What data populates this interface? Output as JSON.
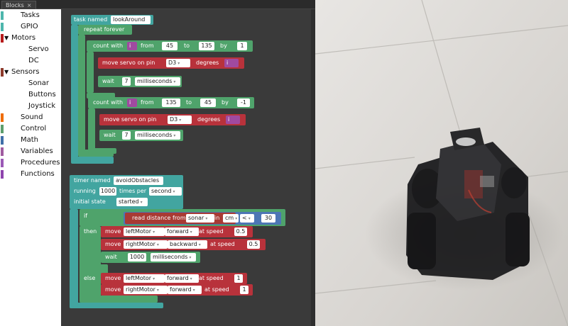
{
  "tab": {
    "label": "Blocks",
    "close": "×"
  },
  "toolbox": [
    {
      "label": "Tasks",
      "color": "#4db6ac",
      "indent": 0
    },
    {
      "label": "GPIO",
      "color": "#4db6ac",
      "indent": 0
    },
    {
      "label": "Motors",
      "color": "#b71c1c",
      "indent": 0,
      "expanded": true
    },
    {
      "label": "Servo",
      "color": "",
      "indent": 1
    },
    {
      "label": "DC",
      "color": "",
      "indent": 1
    },
    {
      "label": "Sensors",
      "color": "#8d3a2b",
      "indent": 0,
      "expanded": true
    },
    {
      "label": "Sonar",
      "color": "",
      "indent": 1
    },
    {
      "label": "Buttons",
      "color": "",
      "indent": 1
    },
    {
      "label": "Joystick",
      "color": "",
      "indent": 1
    },
    {
      "label": "Sound",
      "color": "#ef6c00",
      "indent": 0
    },
    {
      "label": "Control",
      "color": "#5c9e6c",
      "indent": 0
    },
    {
      "label": "Math",
      "color": "#3f6fa8",
      "indent": 0
    },
    {
      "label": "Variables",
      "color": "#a05ba0",
      "indent": 0
    },
    {
      "label": "Procedures",
      "color": "#9b59b6",
      "indent": 0
    },
    {
      "label": "Functions",
      "color": "#8e44ad",
      "indent": 0
    }
  ],
  "arrow": "▼",
  "dropdown_marker": "▾",
  "task": {
    "label": "task named",
    "name": "lookAround",
    "repeat": "repeat forever",
    "loop1": {
      "count_with": "count with",
      "var": "i",
      "from": "from",
      "start": "45",
      "to": "to",
      "end": "135",
      "by": "by",
      "step": "1"
    },
    "loop2": {
      "count_with": "count with",
      "var": "i",
      "from": "from",
      "start": "135",
      "to": "to",
      "end": "45",
      "by": "by",
      "step": "-1"
    },
    "servo": {
      "label": "move servo on pin",
      "pin": "D3",
      "degrees": "degrees",
      "var": "i"
    },
    "wait": {
      "label": "wait",
      "value": "7",
      "unit": "milliseconds"
    }
  },
  "timer": {
    "label": "timer named",
    "name": "avoidObstacles",
    "running": "running",
    "rate": "1000",
    "times_per": "times per",
    "period": "second",
    "initial_state": "initial state",
    "state": "started",
    "if": "if",
    "then": "then",
    "else": "else",
    "read_distance": "read distance from",
    "sensor": "sonar",
    "in": "in",
    "unit": "cm",
    "op": "<",
    "threshold": "30",
    "move": "move",
    "at_speed": "at speed",
    "left_motor": "leftMotor",
    "right_motor": "rightMotor",
    "forward": "forward",
    "backward": "backward",
    "speed_half": "0.5",
    "speed_one": "1",
    "wait": "wait",
    "wait_value": "1000",
    "wait_unit": "milliseconds"
  },
  "colors": {
    "task": "#42a5a0",
    "loop": "#4fa36b",
    "servo": "#b8323b",
    "motor": "#b8323b",
    "sensor": "#a83a34",
    "var": "#a04aa0",
    "math": "#4d76b5"
  }
}
